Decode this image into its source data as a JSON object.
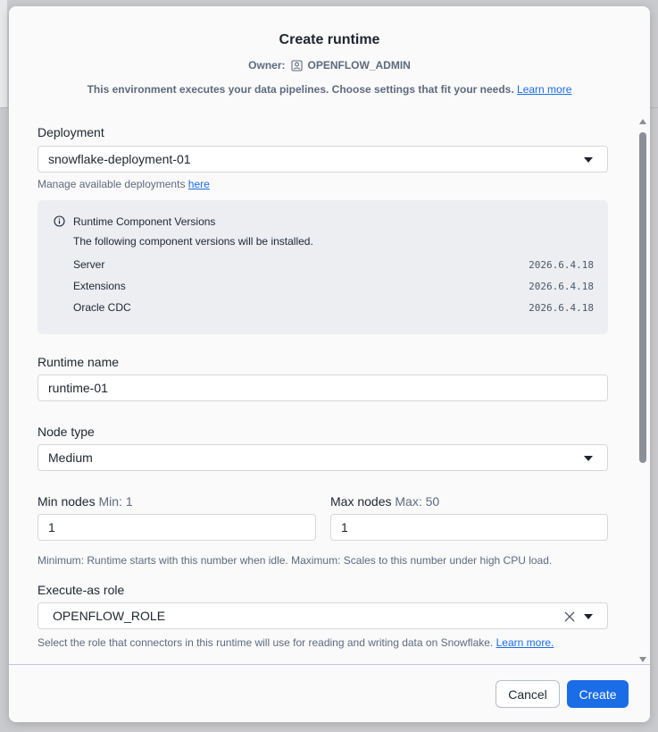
{
  "modal": {
    "title": "Create runtime",
    "owner_label": "Owner:",
    "owner_value": "OPENFLOW_ADMIN",
    "description": "This environment executes your data pipelines. Choose settings that fit your needs.",
    "learn_more": "Learn more"
  },
  "deployment": {
    "label": "Deployment",
    "value": "snowflake-deployment-01",
    "help": "Manage available deployments",
    "help_link": "here"
  },
  "versions": {
    "title": "Runtime Component Versions",
    "subtitle": "The following component versions will be installed.",
    "items": [
      {
        "name": "Server",
        "version": "2026.6.4.18"
      },
      {
        "name": "Extensions",
        "version": "2026.6.4.18"
      },
      {
        "name": "Oracle CDC",
        "version": "2026.6.4.18"
      }
    ]
  },
  "runtime_name": {
    "label": "Runtime name",
    "value": "runtime-01"
  },
  "node_type": {
    "label": "Node type",
    "value": "Medium"
  },
  "min_nodes": {
    "label": "Min nodes",
    "hint": "Min: 1",
    "value": "1"
  },
  "max_nodes": {
    "label": "Max nodes",
    "hint": "Max: 50",
    "value": "1"
  },
  "nodes_help": "Minimum: Runtime starts with this number when idle. Maximum: Scales to this number under high CPU load.",
  "role": {
    "label": "Execute-as role",
    "value": "OPENFLOW_ROLE",
    "help": "Select the role that connectors in this runtime will use for reading and writing data on Snowflake.",
    "learn_more": "Learn more."
  },
  "footer": {
    "cancel": "Cancel",
    "create": "Create"
  },
  "colors": {
    "accent": "#1a6ce7",
    "muted_text": "#5d6a7d",
    "info_bg": "#eceef2"
  }
}
